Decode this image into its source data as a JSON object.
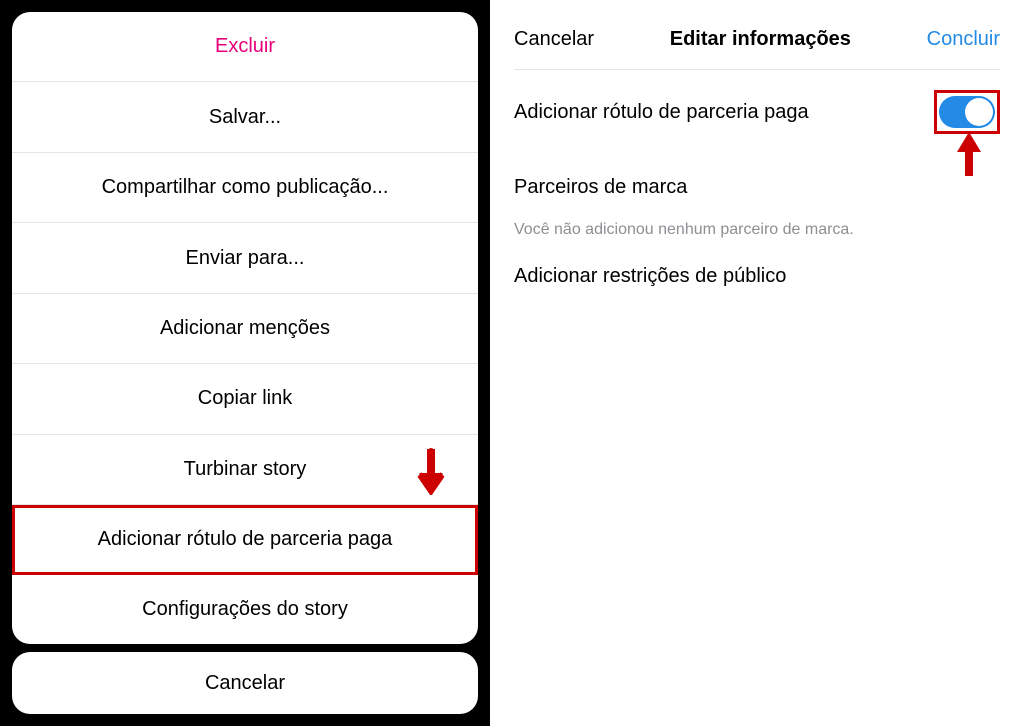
{
  "left": {
    "actions": [
      "Excluir",
      "Salvar...",
      "Compartilhar como publicação...",
      "Enviar para...",
      "Adicionar menções",
      "Copiar link",
      "Turbinar story",
      "Adicionar rótulo de parceria paga",
      "Configurações do story"
    ],
    "cancel": "Cancelar",
    "highlighted_index": 7
  },
  "right": {
    "header": {
      "cancel": "Cancelar",
      "title": "Editar informações",
      "done": "Concluir"
    },
    "paid_label_row": "Adicionar rótulo de parceria paga",
    "paid_label_toggle_on": true,
    "brand_partners_heading": "Parceiros de marca",
    "brand_partners_hint": "Você não adicionou nenhum parceiro de marca.",
    "audience_row": "Adicionar restrições de público"
  },
  "annotations": {
    "highlight_color": "#cc0000"
  }
}
